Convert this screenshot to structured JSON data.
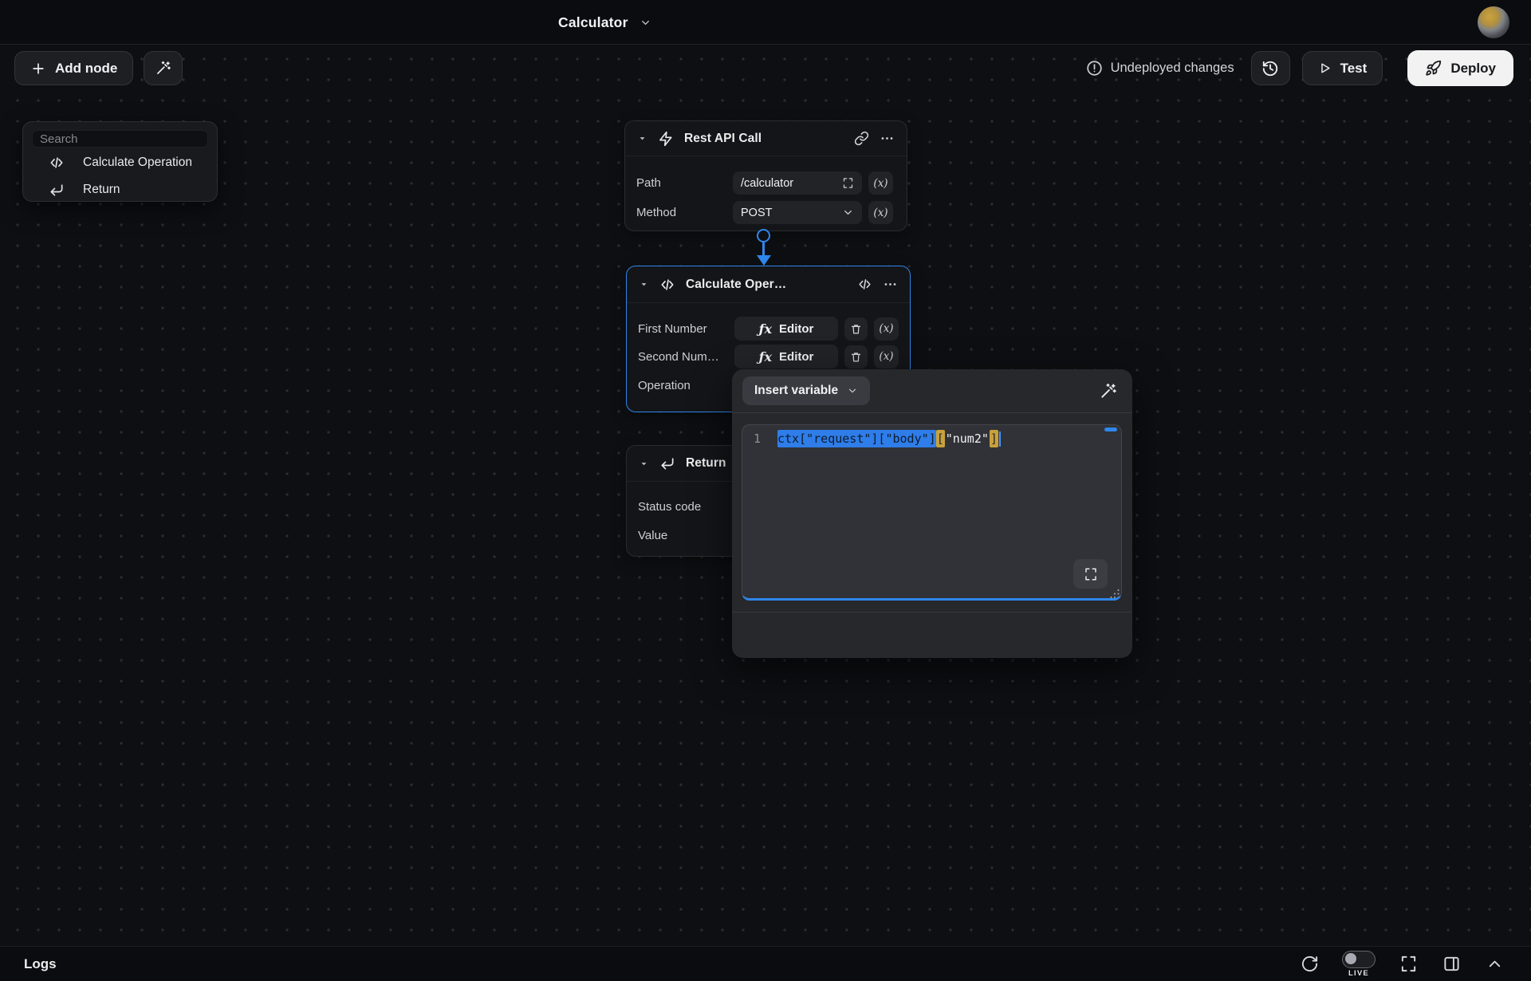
{
  "titlebar": {
    "title": "Calculator"
  },
  "toolbar": {
    "add_node_label": "Add node",
    "undeployed_label": "Undeployed changes",
    "test_label": "Test",
    "deploy_label": "Deploy"
  },
  "search_panel": {
    "placeholder": "Search",
    "items": [
      {
        "label": "Calculate Operation",
        "icon": "code-icon"
      },
      {
        "label": "Return",
        "icon": "return-icon"
      }
    ]
  },
  "icons": {
    "variable": "(x)",
    "fx": "ƒx"
  },
  "nodes": {
    "rest_api_call": {
      "title": "Rest API Call",
      "path_label": "Path",
      "path_value": "/calculator",
      "method_label": "Method",
      "method_value": "POST"
    },
    "calculate_operation": {
      "title": "Calculate Oper…",
      "rows": [
        {
          "label": "First Number",
          "button": "Editor"
        },
        {
          "label": "Second Num…",
          "button": "Editor"
        },
        {
          "label": "Operation"
        }
      ]
    },
    "return": {
      "title": "Return",
      "rows": [
        {
          "label": "Status code"
        },
        {
          "label": "Value"
        }
      ]
    }
  },
  "editor_popup": {
    "insert_variable_label": "Insert variable",
    "line_number": "1",
    "code": {
      "selected": "ctx[\"request\"][\"body\"]",
      "bracket_open": "[",
      "string": "\"num2\"",
      "bracket_close": "]"
    }
  },
  "statusbar": {
    "logs_label": "Logs",
    "live_label": "LIVE"
  },
  "colors": {
    "accent_blue": "#2f86eb",
    "selection_blue": "#2e7de9",
    "bracket_gold": "#c9a13b",
    "deploy_button_bg": "#f2f2f2",
    "canvas_bg": "#0e0f12"
  }
}
